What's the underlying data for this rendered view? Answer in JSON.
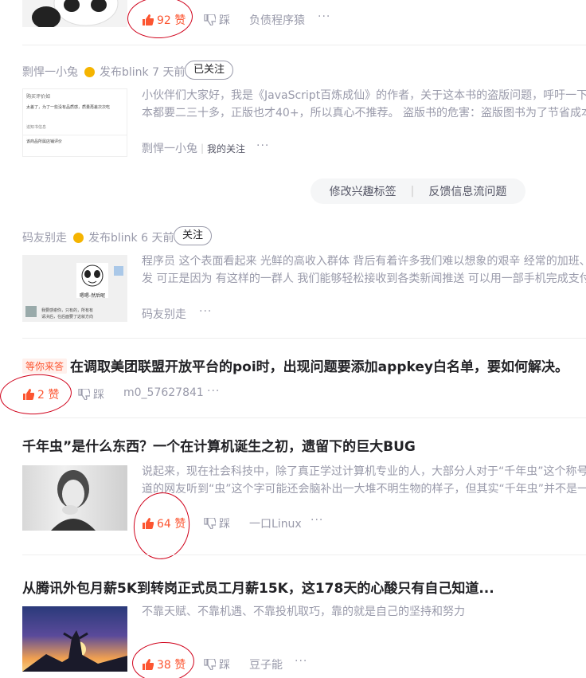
{
  "feed": {
    "item0": {
      "likes": "92 赞",
      "dislike": "踩",
      "author": "负债程序猿",
      "more": "···"
    },
    "blink1": {
      "author": "剽悍一小兔",
      "meta": "发布blink 7 天前",
      "follow": "已关注",
      "text_line1": "小伙伴们大家好，我是《JavaScript百炼成仙》的作者，关于这本书的盗版问题，呼吁一下",
      "text_line2": "本都要二三十多，正版也才40+，所以真心不推荐。 盗版书的危害：盗版图书为了节省成本",
      "foot_author": "剽悍一小兔",
      "foot_tag": "我的关注",
      "more": "···",
      "thumb_line1": "购买评价如",
      "thumb_line2": "太差了，为了一些没有品质感，质量再差次次吃",
      "thumb_line3": "追知书信息",
      "thumb_line4": "该商品所属店铺评价"
    },
    "feedback": {
      "tags": "修改兴趣标签",
      "report": "反馈信息流问题"
    },
    "blink2": {
      "author": "码友别走",
      "meta": "发布blink 6 天前",
      "follow": "关注",
      "text_line1": "程序员 这个表面看起来 光鲜的高收入群体 背后有着许多我们难以想象的艰辛 经常的加班、",
      "text_line2": "发 可正是因为 有这样的一群人 我们能够轻松接收到各类新闻推送 可以用一部手机完成支付",
      "foot_author": "码友别走",
      "more": "···",
      "meme_caption": "嗯嗯-然后呢",
      "chat_line1": "我要感谢你，只有的，所有有",
      "chat_line2": "请决后，在后面要了这就方向"
    },
    "question": {
      "tag": "等你来答",
      "title": "在调取美团联盟开放平台的poi时，出现问题要添加appkey白名单，要如何解决。",
      "likes": "2 赞",
      "dislike": "踩",
      "author": "m0_57627841",
      "more": "···"
    },
    "article1": {
      "title": "千年虫”是什么东西？一个在计算机诞生之初，遗留下的巨大BUG",
      "summary_line1": "说起来，现在社会科技中，除了真正学过计算机专业的人，大部分人对于“千年虫”这个称号试",
      "summary_line2": "道的网友听到“虫”这个字可能还会脑补出一大堆不明生物的样子，但其实“千年虫”并不是一种",
      "likes": "64 赞",
      "dislike": "踩",
      "author": "一口Linux",
      "more": "···"
    },
    "article2": {
      "title": "从腾讯外包月薪5K到转岗正式员工月薪15K，这178天的心酸只有自己知道...",
      "summary": "不靠天赋、不靠机遇、不靠投机取巧，靠的就是自己的坚持和努力",
      "likes": "38 赞",
      "dislike": "踩",
      "author": "豆子能",
      "more": "···"
    }
  },
  "colors": {
    "accent": "#fc5531",
    "muted": "#999aaa",
    "annotation": "#d0021b"
  }
}
